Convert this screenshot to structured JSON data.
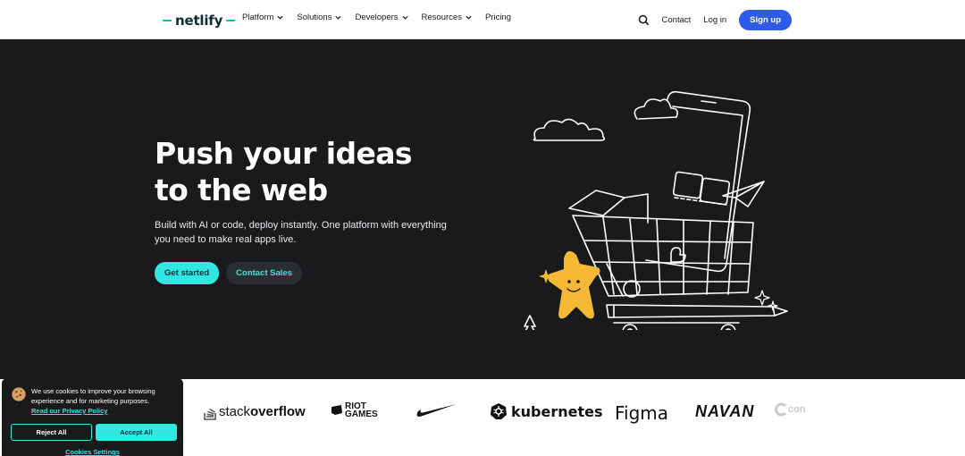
{
  "header": {
    "logo_text": "netlify",
    "nav": [
      "Platform",
      "Solutions",
      "Developers",
      "Resources",
      "Pricing"
    ],
    "contact": "Contact",
    "login": "Log in",
    "signup": "Sign up"
  },
  "hero": {
    "title_line1": "Push your ideas",
    "title_line2": "to the web",
    "subtitle": "Build with AI or code, deploy instantly. One platform with everything you need to make real apps live.",
    "primary_cta": "Get started",
    "secondary_cta": "Contact Sales"
  },
  "logos": {
    "stackoverflow_a": "stack",
    "stackoverflow_b": "overflow",
    "riot_a": "RIOT",
    "riot_b": "GAMES",
    "kubernetes": "kubernetes",
    "figma": "Figma",
    "navan": "NAVAN",
    "con": "con"
  },
  "cookie": {
    "text": "We use cookies to improve your browsing experience and for marketing purposes.",
    "link": "Read our Privacy Policy",
    "reject": "Reject All",
    "accept": "Accept All",
    "settings": "Cookies Settings"
  },
  "colors": {
    "brand_teal": "#32e6e2",
    "signup_blue": "#2f5bea",
    "hero_bg": "#181a1c",
    "mascot_yellow": "#f5b935"
  }
}
